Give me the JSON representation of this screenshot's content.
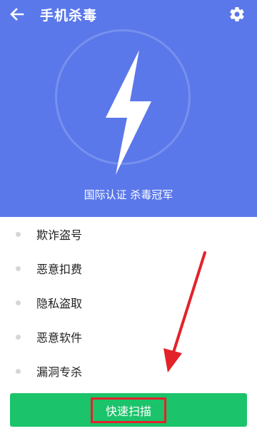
{
  "header": {
    "title": "手机杀毒",
    "back_icon": "back-arrow-icon",
    "settings_icon": "gear-icon"
  },
  "hero": {
    "icon": "lightning-bolt-icon",
    "caption": "国际认证 杀毒冠军",
    "background": "#5a78ea"
  },
  "features": [
    {
      "label": "欺诈盗号"
    },
    {
      "label": "恶意扣费"
    },
    {
      "label": "隐私盗取"
    },
    {
      "label": "恶意软件"
    },
    {
      "label": "漏洞专杀"
    }
  ],
  "action": {
    "scan_label": "快速扫描",
    "button_color": "#1bc36a",
    "highlight_color": "#e3222a"
  }
}
